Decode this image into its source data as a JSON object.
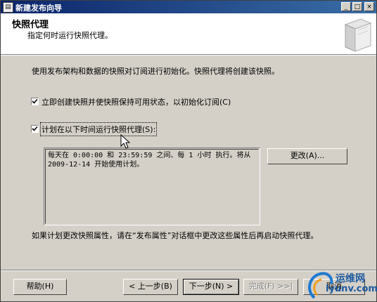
{
  "window": {
    "title": "新建发布向导",
    "minimize": "_",
    "maximize": "□",
    "close": "×"
  },
  "header": {
    "title": "快照代理",
    "subtitle": "指定何时运行快照代理。"
  },
  "main": {
    "description": "使用发布架构和数据的快照对订阅进行初始化。快照代理将创建该快照。",
    "checkbox_immediate": {
      "label": "立即创建快照并使快照保持可用状态，以初始化订阅(C)",
      "checked": true
    },
    "checkbox_schedule": {
      "label": "计划在以下时间运行快照代理(S):",
      "checked": true
    },
    "schedule_text": "每天在 0:00:00 和 23:59:59 之间、每 1 小时 执行。将从\n2009-12-14 开始使用计划。",
    "change_button": "更改(A)...",
    "note": "如果计划更改快照属性，请在“发布属性”对话框中更改这些属性后再启动快照代理。"
  },
  "footer": {
    "help": "帮助(H)",
    "back": "< 上一步(B)",
    "next": "下一步(N) >",
    "finish": "完成(F) >>|",
    "cancel": "取消"
  },
  "watermark": {
    "text": "运维网",
    "url": "iyunv.com"
  }
}
